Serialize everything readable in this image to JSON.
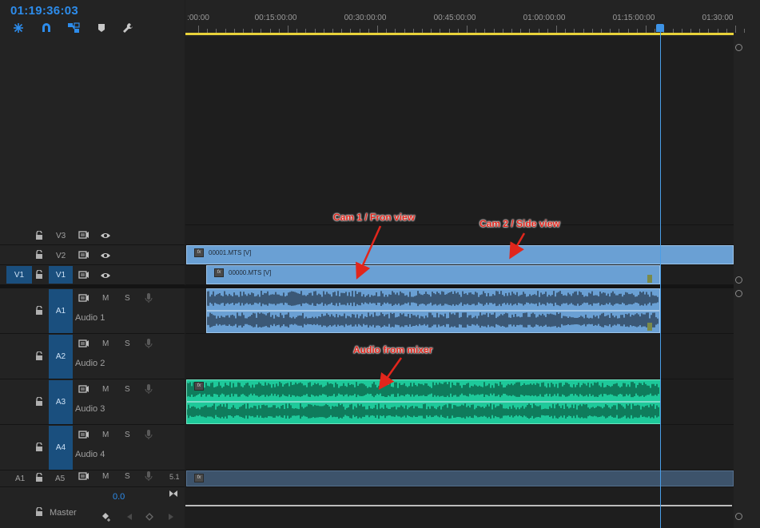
{
  "timecode": "01:19:36:03",
  "toolbar": {
    "tools": [
      "snap-nest-icon",
      "magnet-snap-icon",
      "linked-selection-icon",
      "add-marker-icon",
      "settings-wrench-icon"
    ]
  },
  "ruler": {
    "labels": [
      ":00:00",
      "00:15:00:00",
      "00:30:00:00",
      "00:45:00:00",
      "01:00:00:00",
      "01:15:00:00",
      "01:30:00"
    ]
  },
  "video_tracks": [
    {
      "name": "V3"
    },
    {
      "name": "V2"
    },
    {
      "name": "V1",
      "source_patch": "V1"
    }
  ],
  "audio_tracks": [
    {
      "name": "A1",
      "label": "Audio 1",
      "mute": "M",
      "solo": "S"
    },
    {
      "name": "A2",
      "label": "Audio 2",
      "mute": "M",
      "solo": "S"
    },
    {
      "name": "A3",
      "label": "Audio 3",
      "mute": "M",
      "solo": "S"
    },
    {
      "name": "A4",
      "label": "Audio 4",
      "mute": "M",
      "solo": "S"
    },
    {
      "name": "A5",
      "source_patch": "A1",
      "mute": "M",
      "solo": "S",
      "channel": "5.1"
    }
  ],
  "master": {
    "label": "Master",
    "volume": "0.0"
  },
  "clips": {
    "v2_clip": "00001.MTS [V]",
    "v1_clip": "00000.MTS [V]",
    "fx_badge": "fx"
  },
  "annotations": {
    "cam1": "Cam 1 / Fron view",
    "cam2": "Cam 2 / Side view",
    "mixer": "Audio from mixer"
  },
  "colors": {
    "accent": "#2d8ceb",
    "video_clip": "#6aa0d4",
    "audio_clip_a1": "#6aa0d4",
    "audio_clip_a3": "#1ec99a",
    "annotation": "#e1261c",
    "work_area": "#e8d23a"
  }
}
